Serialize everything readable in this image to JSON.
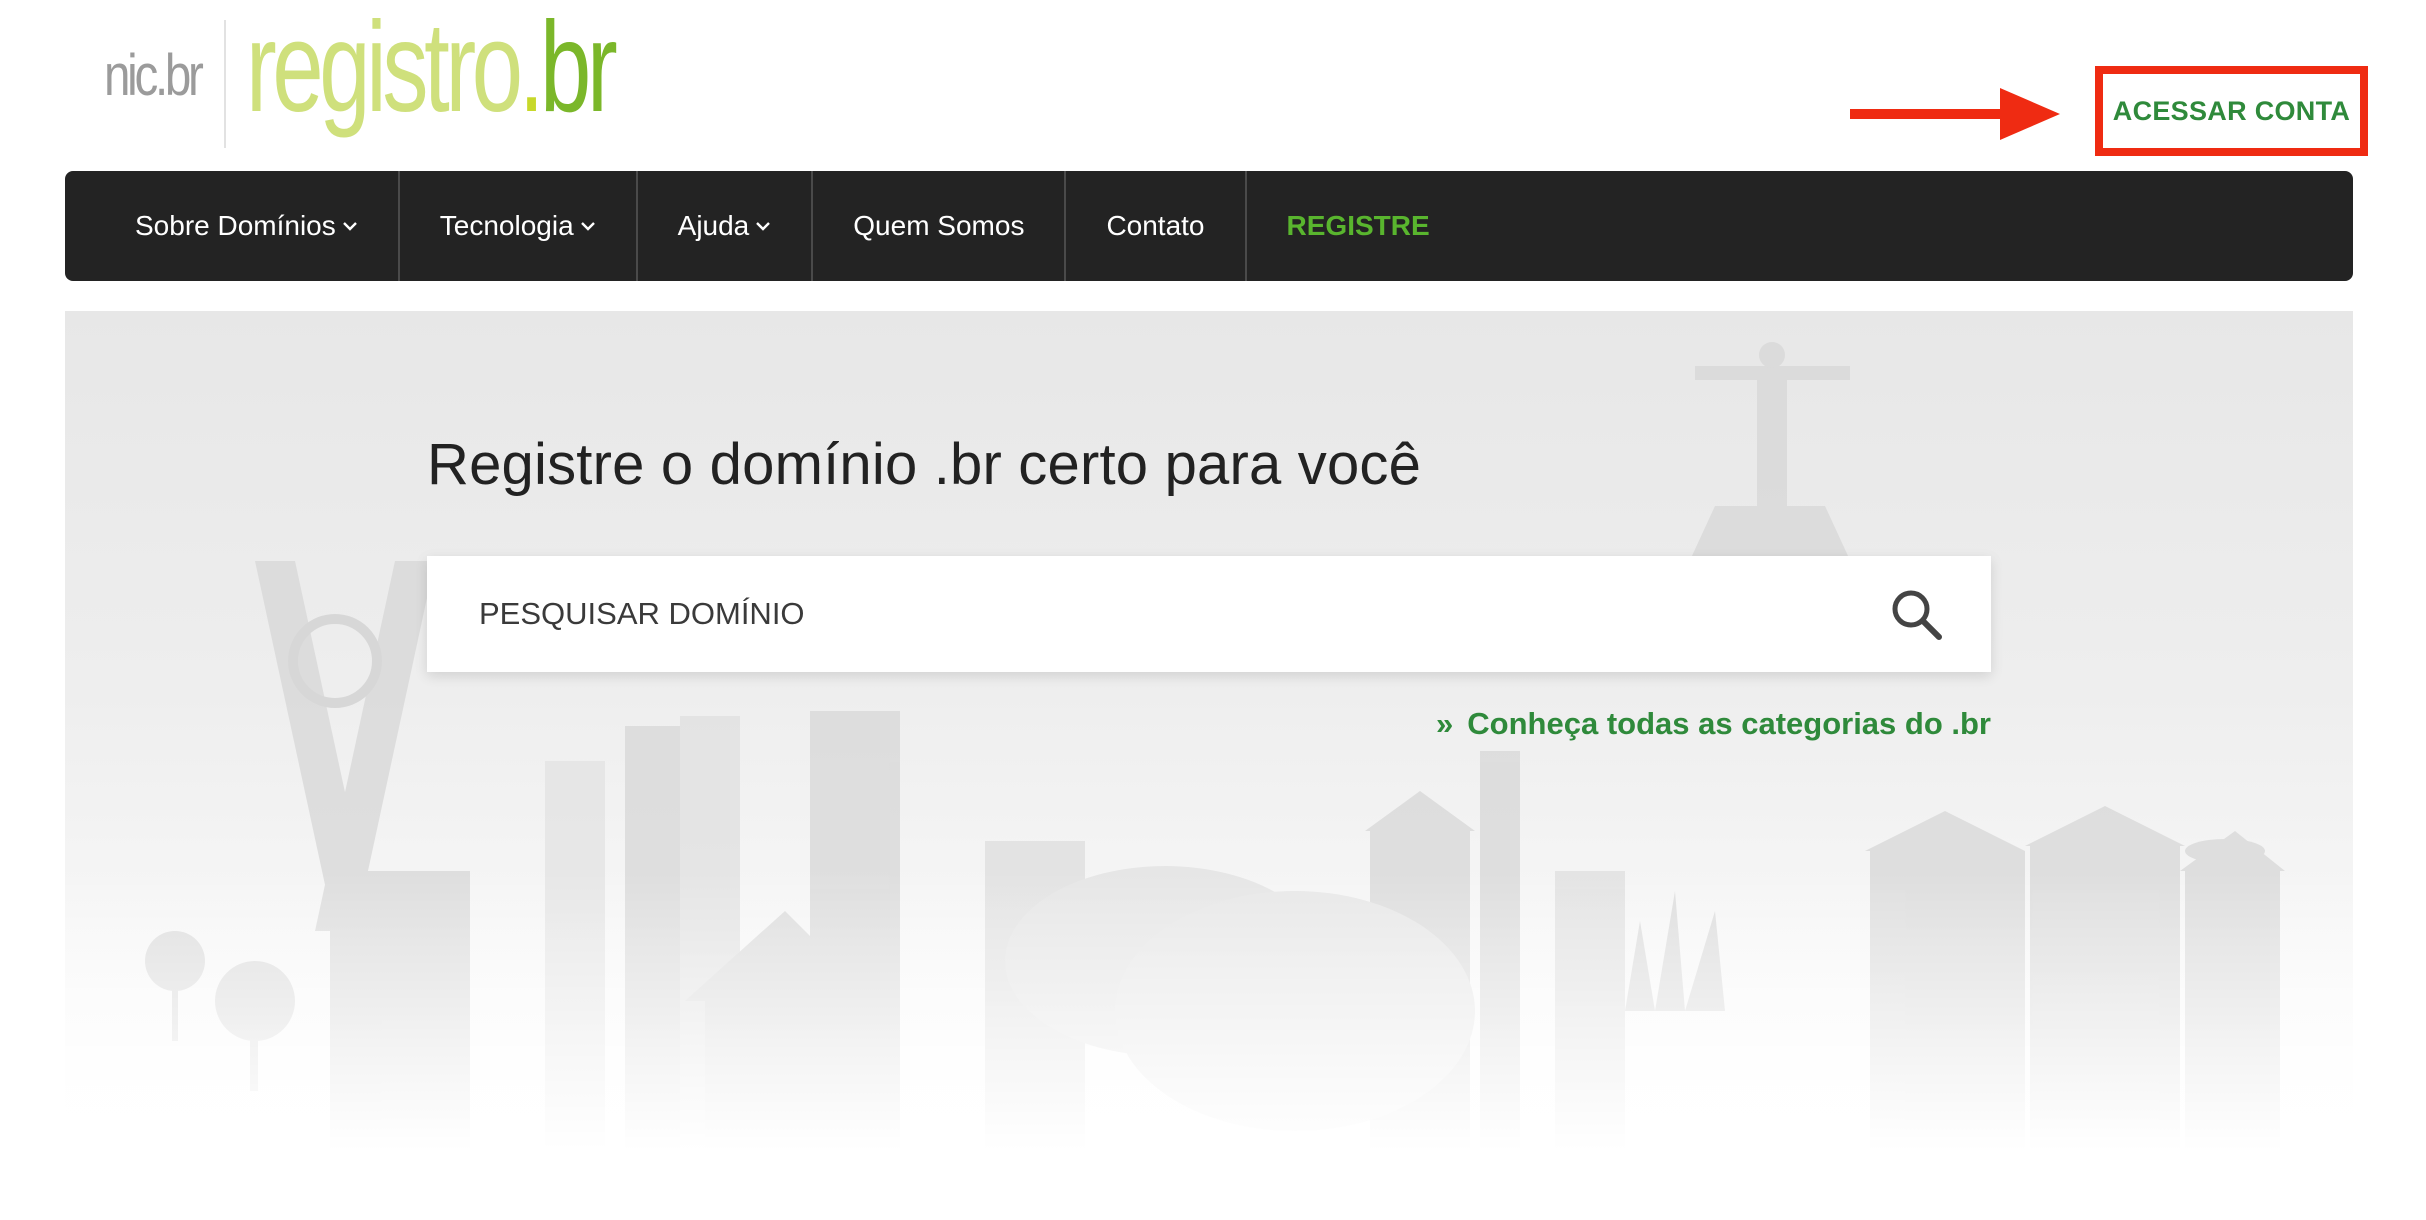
{
  "logo": {
    "nic": "nic.br",
    "registro": "registro",
    "dot": ".",
    "br": "br"
  },
  "account": {
    "label": "ACESSAR CONTA",
    "highlight_color": "#ef2b12"
  },
  "nav": {
    "items": [
      {
        "label": "Sobre Domínios",
        "dropdown": true
      },
      {
        "label": "Tecnologia",
        "dropdown": true
      },
      {
        "label": "Ajuda",
        "dropdown": true
      },
      {
        "label": "Quem Somos",
        "dropdown": false
      },
      {
        "label": "Contato",
        "dropdown": false
      },
      {
        "label": "REGISTRE",
        "dropdown": false
      }
    ]
  },
  "hero": {
    "title": "Registre o domínio .br certo para você",
    "search": {
      "placeholder": "PESQUISAR DOMÍNIO",
      "icon": "search-icon"
    },
    "categories_link": "Conheça todas as categorias do .br",
    "categories_prefix": "»"
  },
  "colors": {
    "brand_green": "#2f8a3b",
    "nav_bg": "#232323",
    "registre_green": "#59b52e",
    "logo_lime": "#cfe07c"
  }
}
